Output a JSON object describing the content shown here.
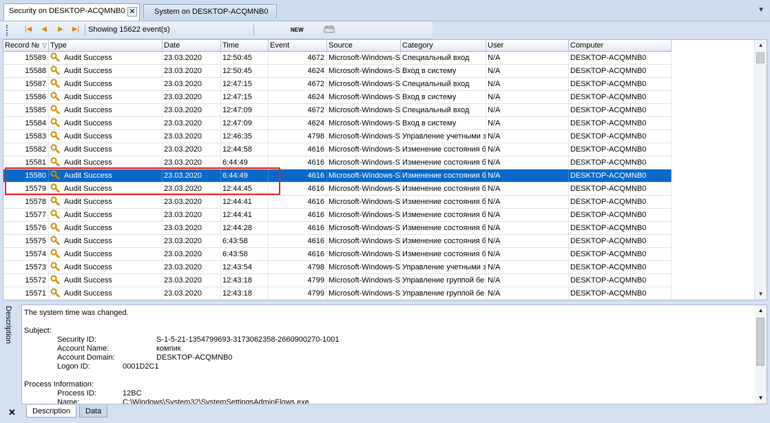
{
  "tabs": [
    {
      "label": "Security on DESKTOP-ACQMNB0",
      "active": true
    },
    {
      "label": "System on DESKTOP-ACQMNB0",
      "active": false
    }
  ],
  "toolbar": {
    "status": "Showing 15622 event(s)",
    "new_label": "NEW"
  },
  "columns": [
    "Record №",
    "Type",
    "Date",
    "Time",
    "Event",
    "Source",
    "Category",
    "User",
    "Computer"
  ],
  "rows": [
    {
      "record": "15589",
      "type": "Audit Success",
      "date": "23.03.2020",
      "time": "12:50:45",
      "event": "4672",
      "source": "Microsoft-Windows-Se",
      "category": "Специальный вход",
      "user": "N/A",
      "computer": "DESKTOP-ACQMNB0"
    },
    {
      "record": "15588",
      "type": "Audit Success",
      "date": "23.03.2020",
      "time": "12:50:45",
      "event": "4624",
      "source": "Microsoft-Windows-Se",
      "category": "Вход в систему",
      "user": "N/A",
      "computer": "DESKTOP-ACQMNB0"
    },
    {
      "record": "15587",
      "type": "Audit Success",
      "date": "23.03.2020",
      "time": "12:47:15",
      "event": "4672",
      "source": "Microsoft-Windows-Se",
      "category": "Специальный вход",
      "user": "N/A",
      "computer": "DESKTOP-ACQMNB0"
    },
    {
      "record": "15586",
      "type": "Audit Success",
      "date": "23.03.2020",
      "time": "12:47:15",
      "event": "4624",
      "source": "Microsoft-Windows-Se",
      "category": "Вход в систему",
      "user": "N/A",
      "computer": "DESKTOP-ACQMNB0"
    },
    {
      "record": "15585",
      "type": "Audit Success",
      "date": "23.03.2020",
      "time": "12:47:09",
      "event": "4672",
      "source": "Microsoft-Windows-Se",
      "category": "Специальный вход",
      "user": "N/A",
      "computer": "DESKTOP-ACQMNB0"
    },
    {
      "record": "15584",
      "type": "Audit Success",
      "date": "23.03.2020",
      "time": "12:47:09",
      "event": "4624",
      "source": "Microsoft-Windows-Se",
      "category": "Вход в систему",
      "user": "N/A",
      "computer": "DESKTOP-ACQMNB0"
    },
    {
      "record": "15583",
      "type": "Audit Success",
      "date": "23.03.2020",
      "time": "12:46:35",
      "event": "4798",
      "source": "Microsoft-Windows-Se",
      "category": "Управление учетными з",
      "user": "N/A",
      "computer": "DESKTOP-ACQMNB0"
    },
    {
      "record": "15582",
      "type": "Audit Success",
      "date": "23.03.2020",
      "time": "12:44:58",
      "event": "4616",
      "source": "Microsoft-Windows-Se",
      "category": "Изменение состояния бе",
      "user": "N/A",
      "computer": "DESKTOP-ACQMNB0"
    },
    {
      "record": "15581",
      "type": "Audit Success",
      "date": "23.03.2020",
      "time": "6:44:49",
      "event": "4616",
      "source": "Microsoft-Windows-Se",
      "category": "Изменение состояния бе",
      "user": "N/A",
      "computer": "DESKTOP-ACQMNB0"
    },
    {
      "record": "15580",
      "type": "Audit Success",
      "date": "23.03.2020",
      "time": "6:44:49",
      "event": "4616",
      "source": "Microsoft-Windows-Se",
      "category": "Изменение состояния бе",
      "user": "N/A",
      "computer": "DESKTOP-ACQMNB0",
      "selected": true
    },
    {
      "record": "15579",
      "type": "Audit Success",
      "date": "23.03.2020",
      "time": "12:44:45",
      "event": "4616",
      "source": "Microsoft-Windows-Se",
      "category": "Изменение состояния бе",
      "user": "N/A",
      "computer": "DESKTOP-ACQMNB0"
    },
    {
      "record": "15578",
      "type": "Audit Success",
      "date": "23.03.2020",
      "time": "12:44:41",
      "event": "4616",
      "source": "Microsoft-Windows-Se",
      "category": "Изменение состояния бе",
      "user": "N/A",
      "computer": "DESKTOP-ACQMNB0"
    },
    {
      "record": "15577",
      "type": "Audit Success",
      "date": "23.03.2020",
      "time": "12:44:41",
      "event": "4616",
      "source": "Microsoft-Windows-Se",
      "category": "Изменение состояния бе",
      "user": "N/A",
      "computer": "DESKTOP-ACQMNB0"
    },
    {
      "record": "15576",
      "type": "Audit Success",
      "date": "23.03.2020",
      "time": "12:44:28",
      "event": "4616",
      "source": "Microsoft-Windows-Se",
      "category": "Изменение состояния бе",
      "user": "N/A",
      "computer": "DESKTOP-ACQMNB0"
    },
    {
      "record": "15575",
      "type": "Audit Success",
      "date": "23.03.2020",
      "time": "6:43:58",
      "event": "4616",
      "source": "Microsoft-Windows-Se",
      "category": "Изменение состояния бе",
      "user": "N/A",
      "computer": "DESKTOP-ACQMNB0"
    },
    {
      "record": "15574",
      "type": "Audit Success",
      "date": "23.03.2020",
      "time": "6:43:58",
      "event": "4616",
      "source": "Microsoft-Windows-Se",
      "category": "Изменение состояния бе",
      "user": "N/A",
      "computer": "DESKTOP-ACQMNB0"
    },
    {
      "record": "15573",
      "type": "Audit Success",
      "date": "23.03.2020",
      "time": "12:43:54",
      "event": "4798",
      "source": "Microsoft-Windows-Se",
      "category": "Управление учетными з",
      "user": "N/A",
      "computer": "DESKTOP-ACQMNB0"
    },
    {
      "record": "15572",
      "type": "Audit Success",
      "date": "23.03.2020",
      "time": "12:43:18",
      "event": "4799",
      "source": "Microsoft-Windows-Se",
      "category": "Управление группой бе",
      "user": "N/A",
      "computer": "DESKTOP-ACQMNB0"
    },
    {
      "record": "15571",
      "type": "Audit Success",
      "date": "23.03.2020",
      "time": "12:43:18",
      "event": "4799",
      "source": "Microsoft-Windows-Se",
      "category": "Управление группой бе",
      "user": "N/A",
      "computer": "DESKTOP-ACQMNB0"
    }
  ],
  "description_panel": {
    "side_label": "Description",
    "lines": [
      {
        "text": "The system time was changed."
      },
      {
        "text": ""
      },
      {
        "text": "Subject:"
      },
      {
        "label": "Security ID:",
        "value": "S-1-5-21-1354799693-3173062358-2660900270-1001"
      },
      {
        "label": "Account Name:",
        "value": "компик"
      },
      {
        "label": "Account Domain:",
        "value": "DESKTOP-ACQMNB0"
      },
      {
        "label": "Logon ID:",
        "value": "0001D2C1"
      },
      {
        "text": ""
      },
      {
        "text": "Process Information:"
      },
      {
        "label": "Process ID:",
        "value": "12BC"
      },
      {
        "label": "Name:",
        "value": "C:\\Windows\\System32\\SystemSettingsAdminFlows.exe"
      }
    ]
  },
  "bottom_tabs": [
    "Description",
    "Data"
  ],
  "colors": {
    "selection": "#0a68c6",
    "highlight_box": "#e02020",
    "key_icon": "#e8a600"
  },
  "icons": {
    "type_icon": "key-icon"
  }
}
